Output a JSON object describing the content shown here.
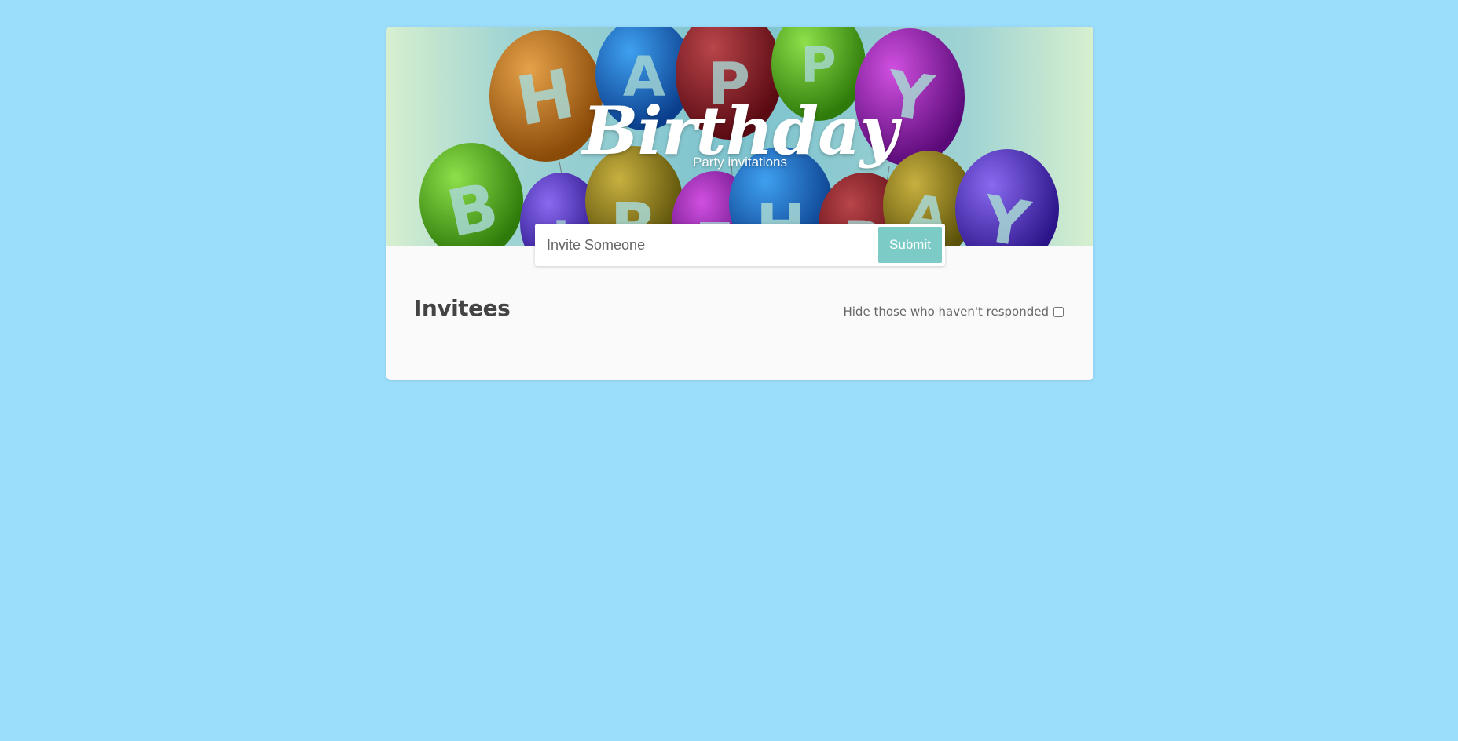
{
  "banner": {
    "title": "Birthday",
    "subtitle": "Party invitations",
    "balloon_letters": [
      "H",
      "A",
      "P",
      "P",
      "Y",
      "B",
      "I",
      "R",
      "T",
      "H",
      "D",
      "A",
      "Y"
    ]
  },
  "invite_form": {
    "input_placeholder": "Invite Someone",
    "input_value": "",
    "submit_label": "Submit"
  },
  "invitees": {
    "heading": "Invitees",
    "filter_label": "Hide those who haven't responded",
    "filter_checked": false
  },
  "colors": {
    "page_background": "#9BDEFC",
    "card_background": "#FAFAFA",
    "submit_button": "#7CCBC6",
    "heading_text": "#444444"
  }
}
